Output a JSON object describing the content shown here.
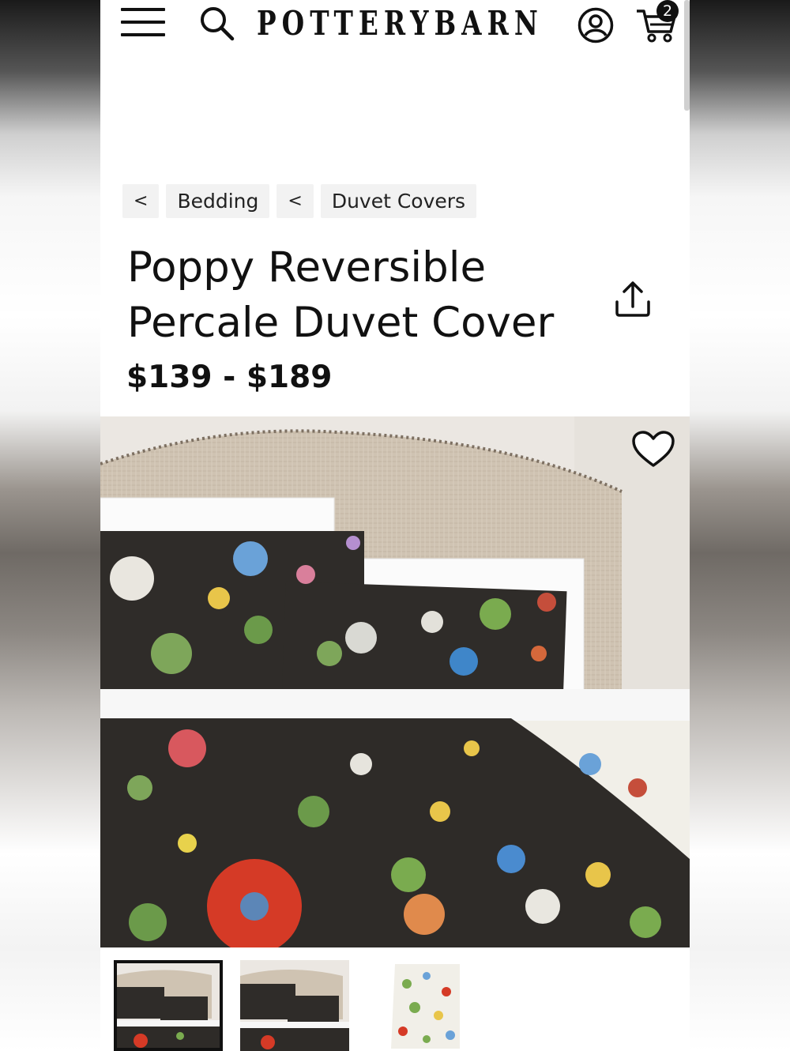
{
  "header": {
    "logo": "POTTERYBARN",
    "cart_count": "2"
  },
  "breadcrumb": {
    "back_glyph_1": "<",
    "item_1": "Bedding",
    "back_glyph_2": "<",
    "item_2": "Duvet Covers"
  },
  "product": {
    "title": "Poppy Reversible Percale Duvet Cover",
    "price": "$139 - $189"
  },
  "colors": {
    "text": "#111111",
    "crumb_bg": "#f2f2f2",
    "duvet_dark": "#2e2b28",
    "headboard": "#cfc3b2"
  },
  "icons": [
    "hamburger-menu-icon",
    "search-icon",
    "account-icon",
    "cart-icon",
    "share-icon",
    "heart-icon"
  ]
}
